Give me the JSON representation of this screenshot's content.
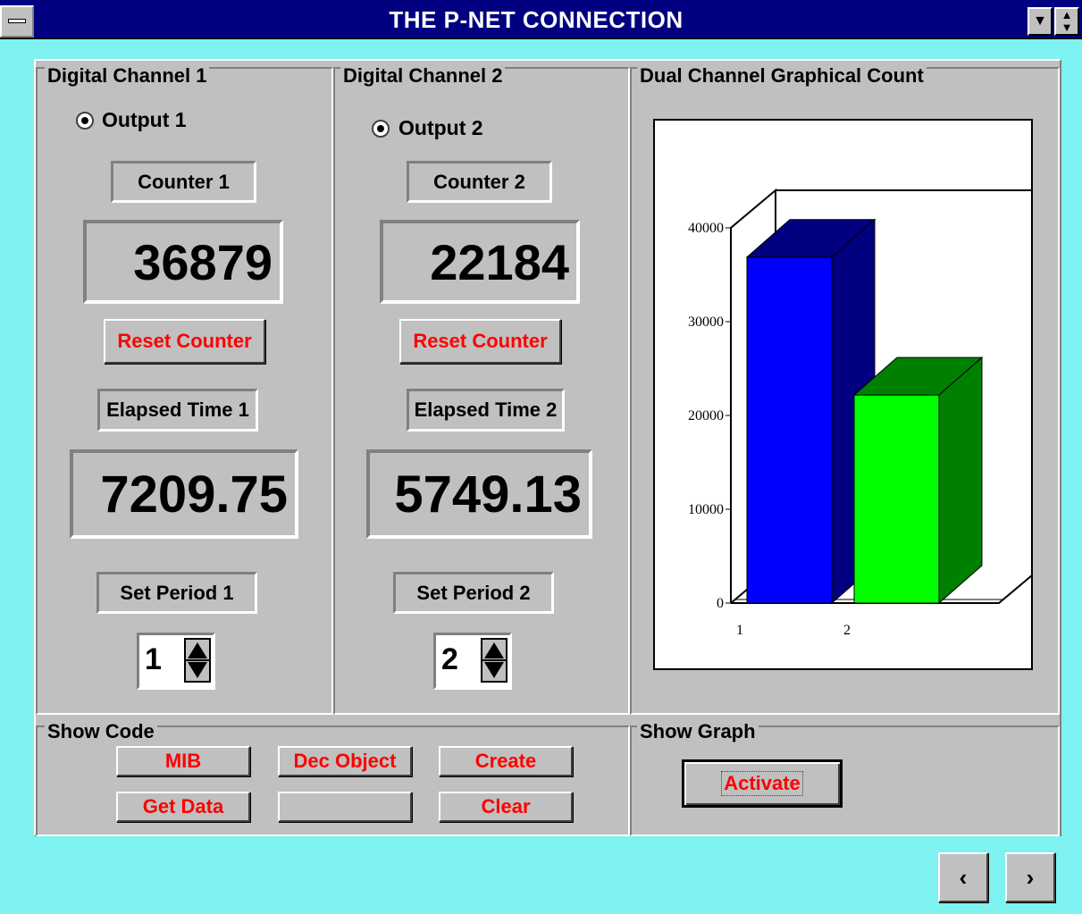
{
  "window": {
    "title": "THE P-NET CONNECTION"
  },
  "channel1": {
    "group_label": "Digital Channel 1",
    "output_label": "Output 1",
    "counter_label": "Counter 1",
    "counter_value": "36879",
    "reset_label": "Reset Counter",
    "elapsed_label": "Elapsed Time 1",
    "elapsed_value": "7209.75",
    "period_label": "Set Period 1",
    "period_value": "1"
  },
  "channel2": {
    "group_label": "Digital Channel 2",
    "output_label": "Output 2",
    "counter_label": "Counter 2",
    "counter_value": "22184",
    "reset_label": "Reset Counter",
    "elapsed_label": "Elapsed Time 2",
    "elapsed_value": "5749.13",
    "period_label": "Set Period 2",
    "period_value": "2"
  },
  "graph_panel": {
    "group_label": "Dual Channel Graphical Count"
  },
  "show_code": {
    "group_label": "Show Code",
    "buttons": [
      "MIB",
      "Dec Object",
      "Create",
      "Get Data",
      "",
      "Clear"
    ]
  },
  "show_graph": {
    "group_label": "Show Graph",
    "activate_label": "Activate"
  },
  "nav": {
    "prev": "‹",
    "next": "›"
  },
  "colors": {
    "desktop": "#7ef2f0",
    "titlebar": "#000080",
    "button_text": "#ff0000",
    "bar1": "#0000ff",
    "bar1_dark": "#000080",
    "bar2": "#00ff00",
    "bar2_dark": "#008000"
  },
  "chart_data": {
    "type": "bar",
    "categories": [
      "1",
      "2"
    ],
    "values": [
      36879,
      22184
    ],
    "ylim": [
      0,
      40000
    ],
    "yticks": [
      "0",
      "10000",
      "20000",
      "30000",
      "40000"
    ],
    "style": "3d",
    "legend": "none"
  }
}
